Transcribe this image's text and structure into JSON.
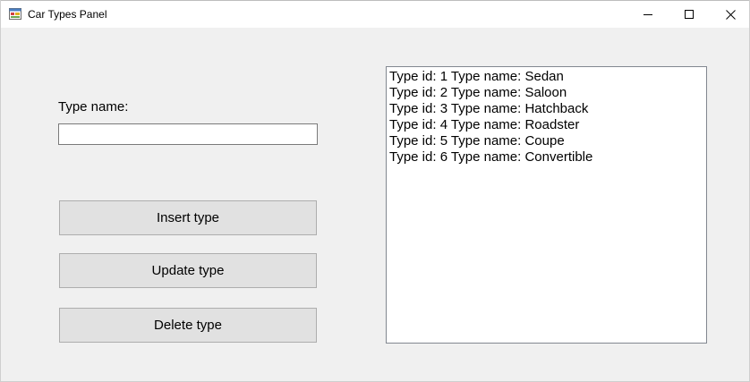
{
  "window": {
    "title": "Car Types Panel",
    "app_icon": "form-icon",
    "controls": {
      "minimize_icon": "minimize-icon",
      "maximize_icon": "maximize-icon",
      "close_icon": "close-icon"
    }
  },
  "form": {
    "type_name_label": "Type name:",
    "type_name_value": "",
    "buttons": {
      "insert": "Insert type",
      "update": "Update type",
      "delete": "Delete type"
    }
  },
  "types_list": {
    "items": [
      "Type id: 1 Type name: Sedan",
      "Type id: 2 Type name: Saloon",
      "Type id: 3 Type name: Hatchback",
      "Type id: 4 Type name: Roadster",
      "Type id: 5 Type name: Coupe",
      "Type id: 6 Type name: Convertible"
    ]
  },
  "colors": {
    "window_background": "#f0f0f0",
    "button_face": "#e1e1e1",
    "button_border": "#adadad"
  }
}
